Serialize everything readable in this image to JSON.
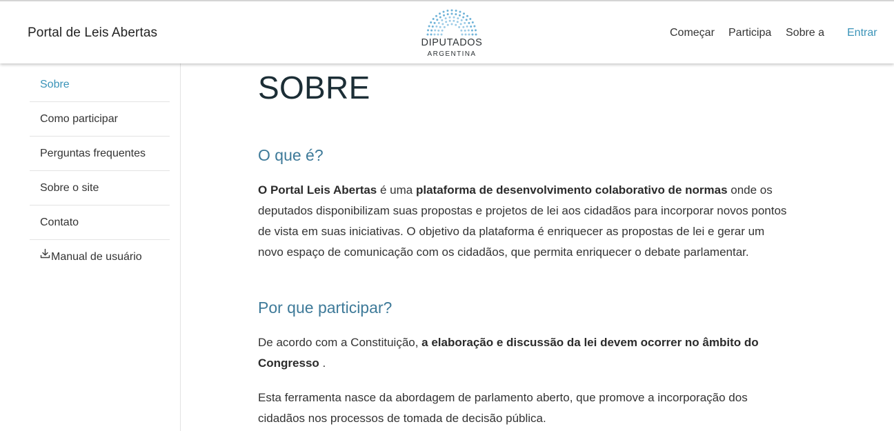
{
  "header": {
    "brand": "Portal de Leis Abertas",
    "logo": {
      "main_text": "DIPUTADOS",
      "sub_text": "ARGENTINA",
      "icon": "hemicycle-logo-icon",
      "accent_color": "#6fb3d8"
    },
    "nav": [
      {
        "label": "Começar"
      },
      {
        "label": "Participa"
      },
      {
        "label": "Sobre a"
      }
    ],
    "login_label": "Entrar"
  },
  "sidebar": {
    "items": [
      {
        "label": "Sobre",
        "active": true
      },
      {
        "label": "Como participar"
      },
      {
        "label": "Perguntas frequentes"
      },
      {
        "label": "Sobre o site"
      },
      {
        "label": "Contato"
      },
      {
        "label": "Manual de usuário",
        "icon": "download-icon"
      }
    ]
  },
  "main": {
    "title": "SOBRE",
    "section1": {
      "heading": "O que é?",
      "p_bold1": "O Portal Leis Abertas",
      "p_text1": " é uma ",
      "p_bold2": "plataforma de desenvolvimento colaborativo de normas",
      "p_text2": " onde os deputados disponibilizam suas propostas e projetos de lei aos cidadãos para incorporar novos pontos de vista em suas iniciativas. O objetivo da plataforma é enriquecer as propostas de lei e gerar um novo espaço de comunicação com os cidadãos, que permita enriquecer o debate parlamentar."
    },
    "section2": {
      "heading": "Por que participar?",
      "p1_text1": "De acordo com a Constituição, ",
      "p1_bold": "a elaboração e discussão da lei devem ocorrer no âmbito do Congresso",
      "p1_text2": " .",
      "p2": "Esta ferramenta nasce da abordagem de parlamento aberto, que promove a incorporação dos cidadãos nos processos de tomada de decisão pública."
    }
  },
  "colors": {
    "accent": "#3a93b8",
    "heading": "#3e7a99",
    "title": "#1c2e36"
  }
}
